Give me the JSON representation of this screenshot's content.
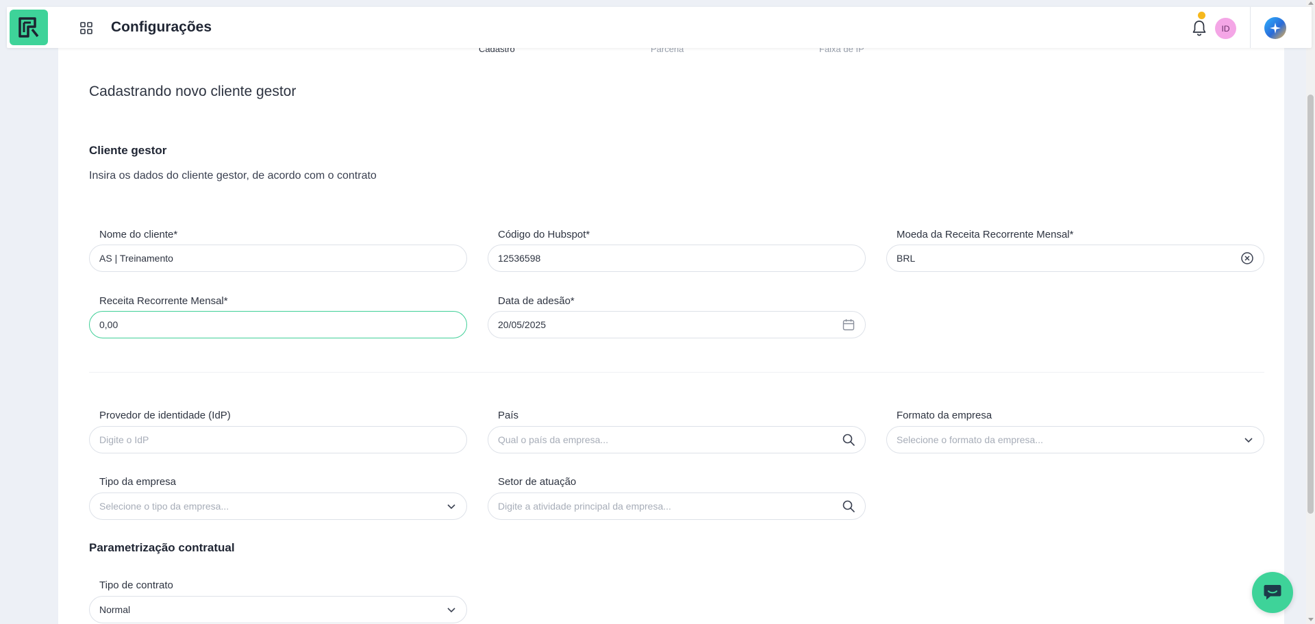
{
  "header": {
    "title": "Configurações",
    "avatar_initials": "ID",
    "brand_color": "#3ed399",
    "notification_dot_color": "#f6b81c"
  },
  "stepper": {
    "steps": [
      {
        "label": "Cadastro",
        "active": true
      },
      {
        "label": "Parceria",
        "active": false
      },
      {
        "label": "Faixa de IP",
        "active": false
      }
    ]
  },
  "page": {
    "title": "Cadastrando novo cliente gestor"
  },
  "client_section": {
    "title": "Cliente gestor",
    "description": "Insira os dados do cliente gestor, de acordo com o contrato"
  },
  "fields": {
    "client_name": {
      "label": "Nome do cliente*",
      "value": "AS | Treinamento"
    },
    "hubspot_code": {
      "label": "Código do Hubspot*",
      "value": "12536598"
    },
    "currency": {
      "label": "Moeda da Receita Recorrente Mensal*",
      "value": "BRL"
    },
    "mrr": {
      "label": "Receita Recorrente Mensal*",
      "value": "0,00"
    },
    "join_date": {
      "label": "Data de adesão*",
      "value": "20/05/2025"
    },
    "idp": {
      "label": "Provedor de identidade (IdP)",
      "placeholder": "Digite o IdP"
    },
    "country": {
      "label": "País",
      "placeholder": "Qual o país da empresa..."
    },
    "company_format": {
      "label": "Formato da empresa",
      "placeholder": "Selecione o formato da empresa..."
    },
    "company_type": {
      "label": "Tipo da empresa",
      "placeholder": "Selecione o tipo da empresa..."
    },
    "sector": {
      "label": "Setor de atuação",
      "placeholder": "Digite a atividade principal da empresa..."
    }
  },
  "contract_section": {
    "title": "Parametrização contratual",
    "contract_type": {
      "label": "Tipo de contrato",
      "value": "Normal"
    }
  }
}
